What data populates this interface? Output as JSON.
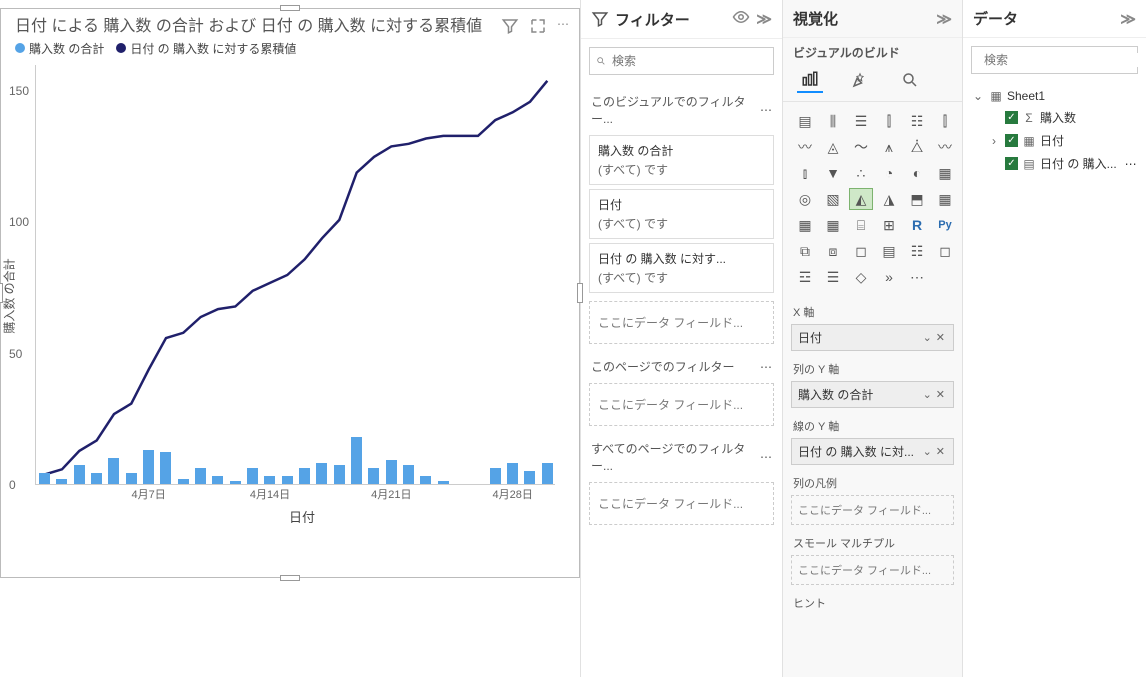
{
  "chart": {
    "title": "日付 による 購入数 の合計 および 日付 の 購入数 に対する累積値",
    "legend": [
      "購入数 の合計",
      "日付 の 購入数 に対する累積値"
    ],
    "legend_colors": [
      "#55a3e6",
      "#20206b"
    ],
    "x_axis_label": "日付",
    "y_axis_label": "購入数 の合計",
    "x_ticks": [
      "4月7日",
      "4月14日",
      "4月21日",
      "4月28日"
    ],
    "y_ticks": [
      0,
      50,
      100,
      150
    ]
  },
  "chart_data": {
    "type": "bar+line",
    "title": "日付 による 購入数 の合計 および 日付 の 購入数 に対する累積値",
    "xlabel": "日付",
    "ylabel": "購入数 の合計",
    "ylim": [
      0,
      160
    ],
    "x_tick_labels": [
      "4月7日",
      "4月14日",
      "4月21日",
      "4月28日"
    ],
    "days": [
      1,
      2,
      3,
      4,
      5,
      6,
      7,
      8,
      9,
      10,
      11,
      12,
      13,
      14,
      15,
      16,
      17,
      18,
      19,
      20,
      21,
      22,
      23,
      24,
      25,
      26,
      27,
      28,
      29,
      30
    ],
    "series": [
      {
        "name": "購入数 の合計",
        "type": "bar",
        "color": "#55a3e6",
        "values": [
          4,
          2,
          7,
          4,
          10,
          4,
          13,
          12,
          2,
          6,
          3,
          1,
          6,
          3,
          3,
          6,
          8,
          7,
          18,
          6,
          9,
          7,
          3,
          1,
          0,
          0,
          6,
          8,
          5,
          8
        ]
      },
      {
        "name": "日付 の 購入数 に対する累積値",
        "type": "line",
        "color": "#20206b",
        "values": [
          4,
          6,
          13,
          17,
          27,
          31,
          44,
          56,
          58,
          64,
          67,
          68,
          74,
          77,
          80,
          86,
          94,
          101,
          119,
          125,
          129,
          130,
          132,
          133,
          133,
          133,
          139,
          142,
          146,
          154
        ]
      }
    ]
  },
  "filters": {
    "pane_title": "フィルター",
    "search_placeholder": "検索",
    "section_visual": "このビジュアルでのフィルター...",
    "cards": [
      {
        "title": "購入数 の合計",
        "sub": "(すべて) です"
      },
      {
        "title": "日付",
        "sub": "(すべて) です"
      },
      {
        "title": "日付 の 購入数 に対す...",
        "sub": "(すべて) です"
      }
    ],
    "drop_here": "ここにデータ フィールド...",
    "section_page": "このページでのフィルター",
    "section_all": "すべてのページでのフィルター..."
  },
  "viz": {
    "pane_title": "視覚化",
    "subtitle": "ビジュアルのビルド",
    "field_sections": {
      "x_axis": "X 軸",
      "x_axis_val": "日付",
      "col_y": "列の Y 軸",
      "col_y_val": "購入数 の合計",
      "line_y": "線の Y 軸",
      "line_y_val": "日付 の 購入数 に対...",
      "legend": "列の凡例",
      "small_mult": "スモール マルチプル",
      "tooltip": "ヒント",
      "drop_here": "ここにデータ フィールド..."
    }
  },
  "data": {
    "pane_title": "データ",
    "search_placeholder": "検索",
    "table": "Sheet1",
    "fields": [
      {
        "label": "購入数",
        "icon": "Σ",
        "checked": true
      },
      {
        "label": "日付",
        "icon": "calendar",
        "checked": true,
        "expandable": true
      },
      {
        "label": "日付 の 購入...",
        "icon": "measure",
        "checked": true
      }
    ]
  }
}
